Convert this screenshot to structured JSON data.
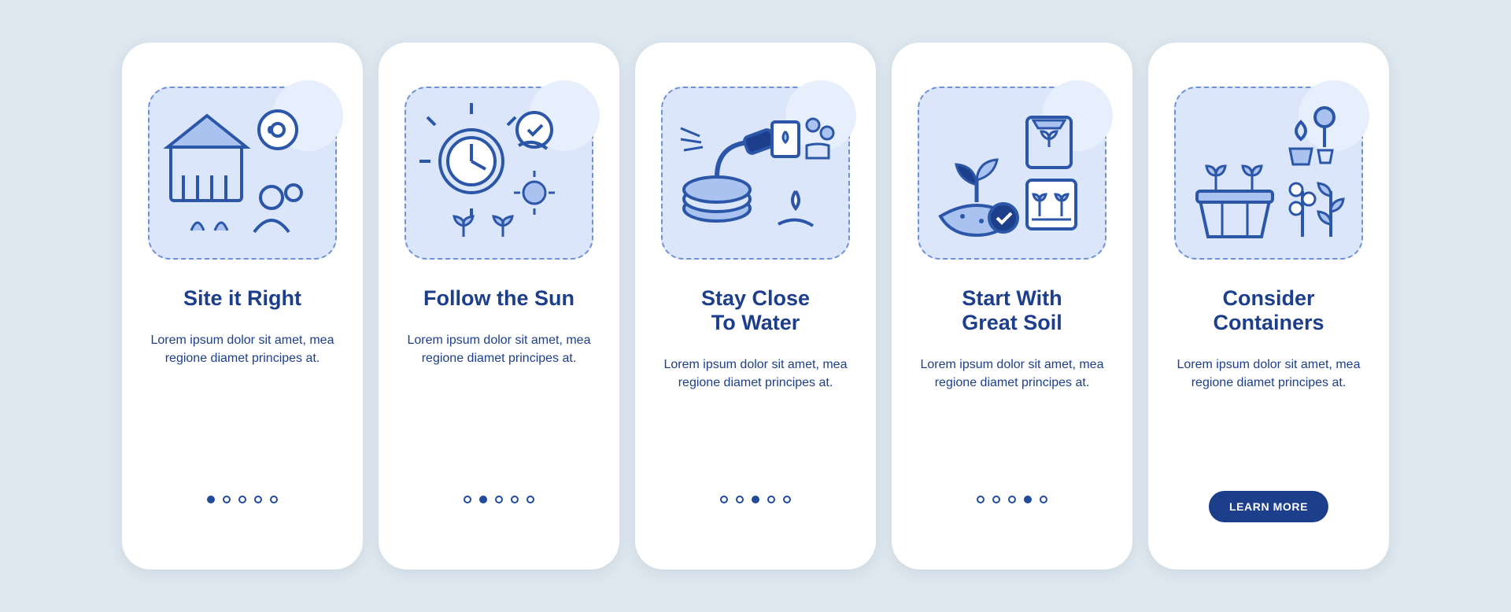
{
  "colors": {
    "primary": "#1d3f8b",
    "stroke": "#2c56a8",
    "fill_light": "#dbe6fb",
    "fill_med": "#a9c2ef",
    "bg": "#dfe8ef"
  },
  "lorem": "Lorem ipsum dolor sit amet, mea regione diamet principes at.",
  "cta_label": "LEARN MORE",
  "cards": [
    {
      "title": "Site it Right",
      "icon": "house-garden-icon",
      "active_index": 0,
      "has_cta": false
    },
    {
      "title": "Follow the Sun",
      "icon": "sun-clock-icon",
      "active_index": 1,
      "has_cta": false
    },
    {
      "title": "Stay Close\nTo Water",
      "icon": "hose-water-icon",
      "active_index": 2,
      "has_cta": false
    },
    {
      "title": "Start With\nGreat Soil",
      "icon": "soil-plant-icon",
      "active_index": 3,
      "has_cta": false
    },
    {
      "title": "Consider\nContainers",
      "icon": "containers-icon",
      "active_index": 4,
      "has_cta": true
    }
  ],
  "total_dots": 5
}
